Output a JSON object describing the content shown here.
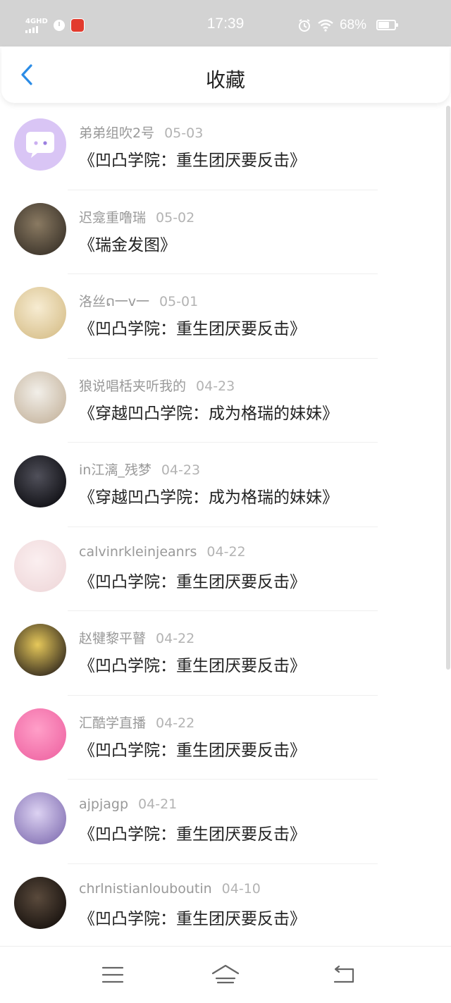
{
  "status_bar": {
    "network": "4GHD",
    "time": "17:39",
    "battery": "68%",
    "battery_level": 0.68,
    "icons": [
      "signal-icon",
      "alarm-icon",
      "app-notification-icon",
      "alarm-clock-icon",
      "wifi-icon",
      "battery-icon"
    ]
  },
  "header": {
    "back_icon": "chevron-left-icon",
    "title": "收藏",
    "accent_color": "#2b8ce6"
  },
  "favorites": [
    {
      "author": "弟弟组吹2号",
      "date": "05-03",
      "title": "《凹凸学院：重生团厌要反击》",
      "avatar_colors": [
        "#d9c5f5",
        "#cbb0f0"
      ]
    },
    {
      "author": "迟龛重噜瑞",
      "date": "05-02",
      "title": "《瑞金发图》",
      "avatar_colors": [
        "#8a7a62",
        "#3e362c"
      ]
    },
    {
      "author": "洛丝ດ一v一",
      "date": "05-01",
      "title": "《凹凸学院：重生团厌要反击》",
      "avatar_colors": [
        "#f7ecd2",
        "#d9c28f"
      ]
    },
    {
      "author": "狼说唱栝夹听我的",
      "date": "04-23",
      "title": "《穿越凹凸学院：成为格瑞的妹妹》",
      "avatar_colors": [
        "#f2efe9",
        "#c9b9a4"
      ]
    },
    {
      "author": "in江漓_残梦",
      "date": "04-23",
      "title": "《穿越凹凸学院：成为格瑞的妹妹》",
      "avatar_colors": [
        "#50505a",
        "#111116"
      ]
    },
    {
      "author": "calvinrkleinjeanrs",
      "date": "04-22",
      "title": "《凹凸学院：重生团厌要反击》",
      "avatar_colors": [
        "#fbeff0",
        "#f0dadc"
      ]
    },
    {
      "author": "赵犍黎平瞽",
      "date": "04-22",
      "title": "《凹凸学院：重生团厌要反击》",
      "avatar_colors": [
        "#e6c85a",
        "#3a3020"
      ]
    },
    {
      "author": "汇酷学直播",
      "date": "04-22",
      "title": "《凹凸学院：重生团厌要反击》",
      "avatar_colors": [
        "#ff9fc8",
        "#f06aa6"
      ]
    },
    {
      "author": "ajpjagp",
      "date": "04-21",
      "title": "《凹凸学院：重生团厌要反击》",
      "avatar_colors": [
        "#dcd2f2",
        "#8a78b8"
      ]
    },
    {
      "author": "chrlnistianlouboutin",
      "date": "04-10",
      "title": "《凹凸学院：重生团厌要反击》",
      "avatar_colors": [
        "#5a4a3c",
        "#1a1410"
      ]
    }
  ],
  "nav": {
    "items": [
      {
        "name": "menu-icon"
      },
      {
        "name": "home-icon"
      },
      {
        "name": "back-icon"
      }
    ]
  }
}
